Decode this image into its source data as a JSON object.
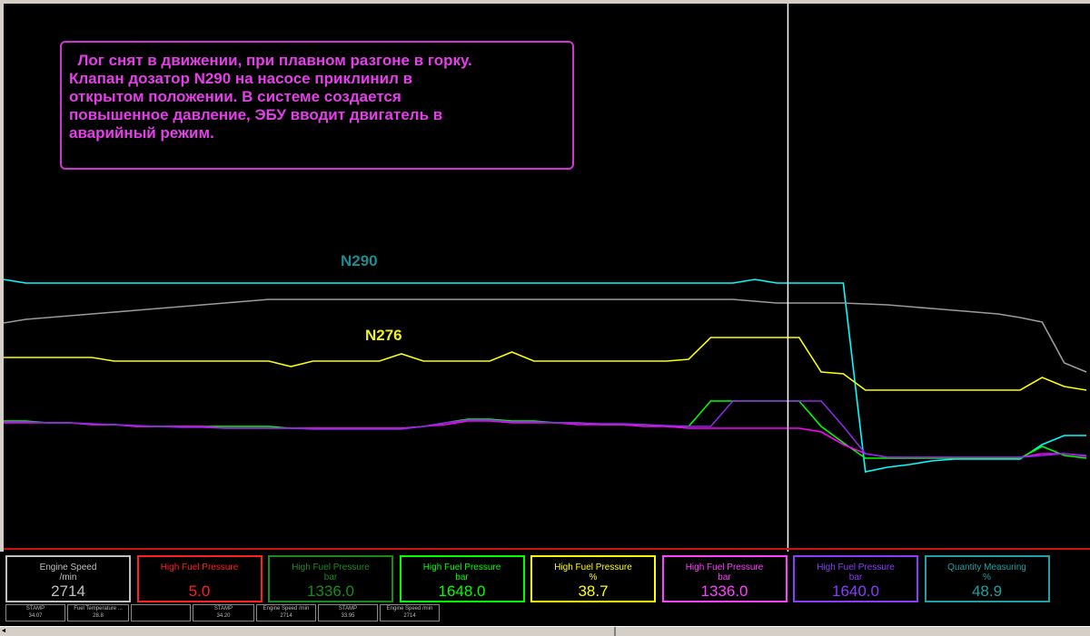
{
  "annotation": {
    "lines": [
      "  Лог снят в движении, при плавном разгоне в горку.",
      "Клапан дозатор N290 на насосе приклинил в",
      "открытом положении. В системе создается",
      "повышенное давление, ЭБУ вводит двигатель в",
      "аварийный режим."
    ]
  },
  "labels": {
    "n290": "N290",
    "n276": "N276"
  },
  "colors": {
    "background": "#000000",
    "cursor": "#ffffff",
    "annotation": "#e040e8",
    "n290_label": "#1f8a8f",
    "n276_label": "#f0f020"
  },
  "chart_data": {
    "type": "line",
    "title": "",
    "xlabel": "",
    "ylabel": "",
    "x": [
      0,
      1,
      2,
      3,
      4,
      5,
      6,
      7,
      8,
      9,
      10,
      11,
      12,
      13,
      14,
      15,
      16,
      17,
      18,
      19,
      20,
      21,
      22,
      23,
      24,
      25,
      26,
      27,
      28,
      29,
      30,
      31,
      32,
      33,
      34,
      35,
      36,
      37,
      38,
      39,
      40,
      41,
      42,
      43,
      44,
      45,
      46,
      47,
      48,
      49
    ],
    "cursor_x": 35,
    "series": [
      {
        "color": "#00ffff",
        "values": [
          308,
          312,
          312,
          312,
          312,
          312,
          312,
          312,
          312,
          312,
          312,
          312,
          312,
          312,
          312,
          312,
          312,
          312,
          312,
          312,
          312,
          312,
          312,
          312,
          312,
          312,
          312,
          312,
          312,
          312,
          312,
          312,
          312,
          312,
          308,
          312,
          312,
          312,
          312,
          520,
          515,
          512,
          508,
          506,
          506,
          506,
          506,
          490,
          480,
          480
        ]
      },
      {
        "color": "#9a9a9a",
        "values": [
          356,
          352,
          350,
          348,
          346,
          344,
          342,
          340,
          338,
          336,
          334,
          332,
          330,
          330,
          330,
          330,
          330,
          330,
          330,
          330,
          330,
          330,
          330,
          330,
          330,
          330,
          330,
          330,
          330,
          330,
          330,
          330,
          330,
          330,
          332,
          334,
          334,
          334,
          334,
          335,
          336,
          338,
          340,
          342,
          344,
          346,
          350,
          355,
          400,
          410
        ]
      },
      {
        "color": "#ffff00",
        "values": [
          394,
          394,
          394,
          394,
          394,
          398,
          398,
          398,
          398,
          398,
          398,
          398,
          398,
          404,
          398,
          398,
          398,
          398,
          390,
          398,
          398,
          398,
          398,
          388,
          398,
          398,
          398,
          398,
          398,
          398,
          398,
          396,
          372,
          372,
          372,
          372,
          372,
          410,
          412,
          430,
          430,
          430,
          430,
          430,
          430,
          430,
          430,
          416,
          426,
          430
        ]
      },
      {
        "color": "#00ff00",
        "values": [
          464,
          464,
          466,
          466,
          468,
          468,
          470,
          470,
          470,
          470,
          470,
          470,
          470,
          472,
          472,
          472,
          472,
          472,
          472,
          470,
          466,
          462,
          462,
          464,
          464,
          466,
          466,
          468,
          468,
          468,
          470,
          470,
          442,
          442,
          442,
          442,
          442,
          470,
          488,
          505,
          505,
          505,
          505,
          505,
          505,
          505,
          505,
          492,
          502,
          505
        ]
      },
      {
        "color": "#ff00ff",
        "values": [
          466,
          466,
          466,
          466,
          468,
          468,
          470,
          470,
          470,
          470,
          472,
          472,
          472,
          472,
          472,
          472,
          472,
          472,
          472,
          470,
          468,
          464,
          464,
          466,
          466,
          466,
          468,
          468,
          468,
          470,
          470,
          472,
          472,
          472,
          472,
          472,
          472,
          476,
          490,
          500,
          504,
          504,
          504,
          504,
          504,
          504,
          504,
          500,
          500,
          503
        ]
      },
      {
        "color": "#8a2be2",
        "values": [
          465,
          465,
          466,
          466,
          467,
          468,
          469,
          470,
          471,
          471,
          472,
          472,
          472,
          472,
          473,
          473,
          473,
          473,
          473,
          470,
          466,
          463,
          463,
          465,
          465,
          466,
          466,
          467,
          467,
          468,
          469,
          470,
          470,
          442,
          442,
          442,
          442,
          442,
          470,
          500,
          504,
          504,
          504,
          504,
          504,
          504,
          504,
          502,
          500,
          502
        ]
      }
    ]
  },
  "gauges": [
    {
      "title": "Engine Speed",
      "unit": "/min",
      "value": "2714",
      "color": "#c0c0c0",
      "valcolor": "#c0c0c0"
    },
    {
      "title": "High Fuel Pressure",
      "unit": "",
      "value": "5.0",
      "color": "#ff2020",
      "valcolor": "#ff2020"
    },
    {
      "title": "High Fuel Pressure",
      "unit": "bar",
      "value": "1336.0",
      "color": "#1a8a1a",
      "valcolor": "#1a8a1a"
    },
    {
      "title": "High Fuel Pressure",
      "unit": "bar",
      "value": "1648.0",
      "color": "#00ff00",
      "valcolor": "#00ff00"
    },
    {
      "title": "High Fuel Pressure",
      "unit": "%",
      "value": "38.7",
      "color": "#ffff00",
      "valcolor": "#ffff00"
    },
    {
      "title": "High Fuel Pressure",
      "unit": "bar",
      "value": "1336.0",
      "color": "#ff40ff",
      "valcolor": "#ff40ff"
    },
    {
      "title": "High Fuel Pressure",
      "unit": "bar",
      "value": "1640.0",
      "color": "#8a3cff",
      "valcolor": "#8a3cff"
    },
    {
      "title": "Quantity Measuring",
      "unit": "%",
      "value": "48.9",
      "color": "#20a0a0",
      "valcolor": "#20a0a0"
    }
  ],
  "stamps": [
    {
      "title": "STAMP",
      "value": "34.07"
    },
    {
      "title": "Fuel Temperature ...",
      "value": "28.8"
    },
    {
      "title": "",
      "value": ""
    },
    {
      "title": "STAMP",
      "value": "34.20"
    },
    {
      "title": "Engine Speed /min",
      "value": "2714"
    },
    {
      "title": "STAMP",
      "value": "33.95"
    },
    {
      "title": "Engine Speed /min",
      "value": "2714"
    }
  ],
  "scroll": {
    "left_arrow": "◄"
  }
}
